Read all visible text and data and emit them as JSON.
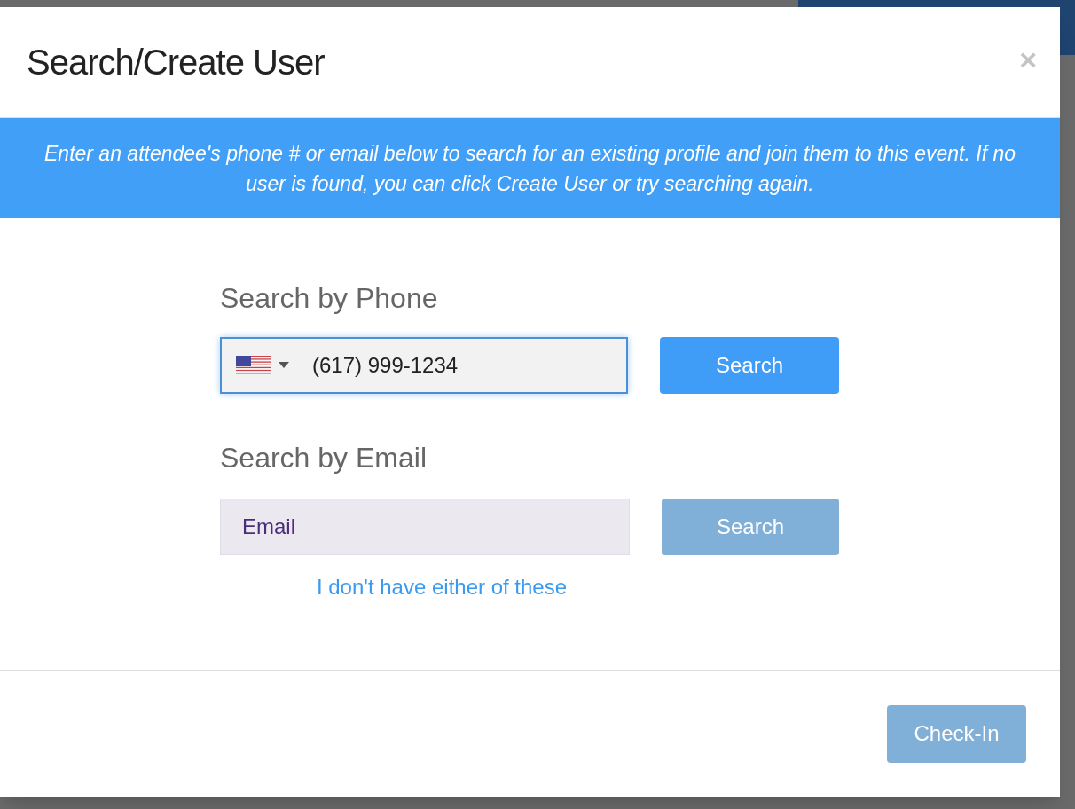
{
  "modal": {
    "title": "Search/Create User",
    "close": "×"
  },
  "banner": "Enter an attendee's phone # or email below to search for an existing profile and join them to this event. If no user is found, you can click Create User or try searching again.",
  "phone_section": {
    "label": "Search by Phone",
    "value": "(617) 999-1234",
    "focused": true,
    "button": {
      "label": "Search",
      "disabled": false
    }
  },
  "email_section": {
    "label": "Search by Email",
    "placeholder": "Email",
    "focused": false,
    "button": {
      "label": "Search",
      "disabled": true
    }
  },
  "alt_link": "I don't have either of these",
  "footer": {
    "button": {
      "label": "Check-In",
      "disabled": true
    }
  }
}
